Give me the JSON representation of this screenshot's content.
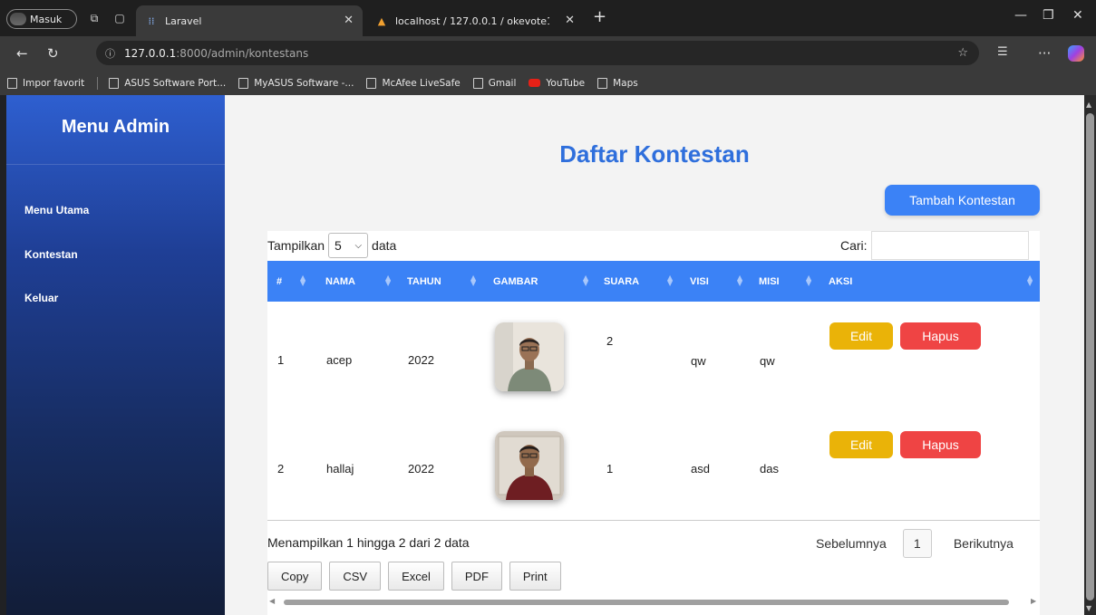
{
  "browser": {
    "profile_label": "Masuk",
    "tabs": [
      {
        "title": "Laravel",
        "active": true
      },
      {
        "title": "localhost / 127.0.0.1 / okevote112",
        "active": false
      }
    ],
    "url_host": "127.0.0.1",
    "url_path": ":8000/admin/kontestans",
    "bookmarks": [
      "Impor favorit",
      "ASUS Software Port...",
      "MyASUS Software -...",
      "McAfee LiveSafe",
      "Gmail",
      "YouTube",
      "Maps"
    ]
  },
  "sidebar": {
    "title": "Menu Admin",
    "items": [
      "Menu Utama",
      "Kontestan",
      "Keluar"
    ],
    "gradient_top": "#2e5fd0",
    "gradient_bottom": "#121d38"
  },
  "main": {
    "title": "Daftar Kontestan",
    "add_button": "Tambah Kontestan",
    "length_prefix": "Tampilkan",
    "length_value": "5",
    "length_suffix": "data",
    "search_label": "Cari:",
    "columns": [
      "#",
      "NAMA",
      "TAHUN",
      "GAMBAR",
      "SUARA",
      "VISI",
      "MISI",
      "AKSI"
    ],
    "rows": [
      {
        "no": "1",
        "nama": "acep",
        "tahun": "2022",
        "suara": "2",
        "visi": "qw",
        "misi": "qw"
      },
      {
        "no": "2",
        "nama": "hallaj",
        "tahun": "2022",
        "suara": "1",
        "visi": "asd",
        "misi": "das"
      }
    ],
    "edit_label": "Edit",
    "delete_label": "Hapus",
    "info": "Menampilkan 1 hingga 2 dari 2 data",
    "prev_label": "Sebelumnya",
    "current_page": "1",
    "next_label": "Berikutnya",
    "export_buttons": [
      "Copy",
      "CSV",
      "Excel",
      "PDF",
      "Print"
    ]
  },
  "colors": {
    "accent": "#3b82f6",
    "title": "#2f6fdc",
    "edit": "#eab308",
    "delete": "#ef4444"
  }
}
